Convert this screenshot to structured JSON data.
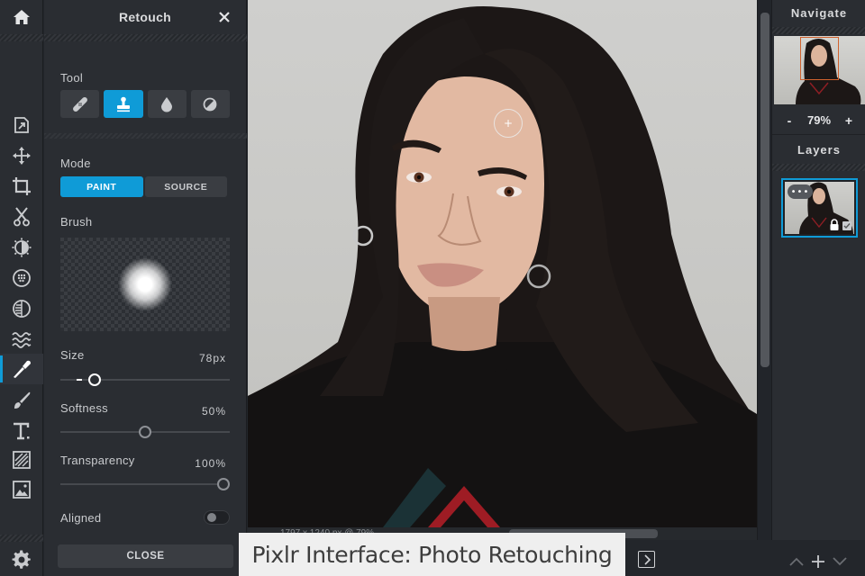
{
  "app": {
    "name": "Pixlr",
    "caption": "Pixlr Interface: Photo Retouching"
  },
  "toolbar": {
    "items": [
      {
        "name": "arrange",
        "icon": "arrange-icon"
      },
      {
        "name": "move",
        "icon": "move-icon"
      },
      {
        "name": "crop",
        "icon": "crop-icon"
      },
      {
        "name": "cutout",
        "icon": "scissors-icon"
      },
      {
        "name": "adjustment",
        "icon": "adjust-icon"
      },
      {
        "name": "filter",
        "icon": "filter-icon"
      },
      {
        "name": "effect",
        "icon": "effect-icon"
      },
      {
        "name": "liquify",
        "icon": "liquify-icon"
      },
      {
        "name": "retouch",
        "icon": "retouch-icon",
        "active": true
      },
      {
        "name": "draw",
        "icon": "brush-icon"
      },
      {
        "name": "text",
        "icon": "text-icon"
      },
      {
        "name": "add-element",
        "icon": "pattern-icon"
      },
      {
        "name": "add-image",
        "icon": "image-icon"
      }
    ],
    "accent": "#0f9bd7"
  },
  "panel": {
    "title": "Retouch",
    "tool_label": "Tool",
    "tools": [
      {
        "name": "heal",
        "icon": "bandage-icon"
      },
      {
        "name": "clone",
        "icon": "stamp-icon",
        "active": true
      },
      {
        "name": "blur",
        "icon": "drop-icon"
      },
      {
        "name": "dodge-burn",
        "icon": "contrast-icon"
      }
    ],
    "mode_label": "Mode",
    "modes": [
      "PAINT",
      "SOURCE"
    ],
    "active_mode": "PAINT",
    "brush_label": "Brush",
    "size_label": "Size",
    "size_value": "78px",
    "size_fraction": 0.18,
    "softness_label": "Softness",
    "softness_value": "50%",
    "softness_fraction": 0.5,
    "transparency_label": "Transparency",
    "transparency_value": "100%",
    "transparency_fraction": 1.0,
    "aligned_label": "Aligned",
    "aligned_on": false,
    "close_label": "CLOSE"
  },
  "canvas": {
    "status": "1797 x 1240 px @ 79%"
  },
  "navigate": {
    "title": "Navigate",
    "zoom_minus": "-",
    "zoom_value": "79%",
    "zoom_plus": "+"
  },
  "layers": {
    "title": "Layers",
    "more_label": "•••"
  }
}
